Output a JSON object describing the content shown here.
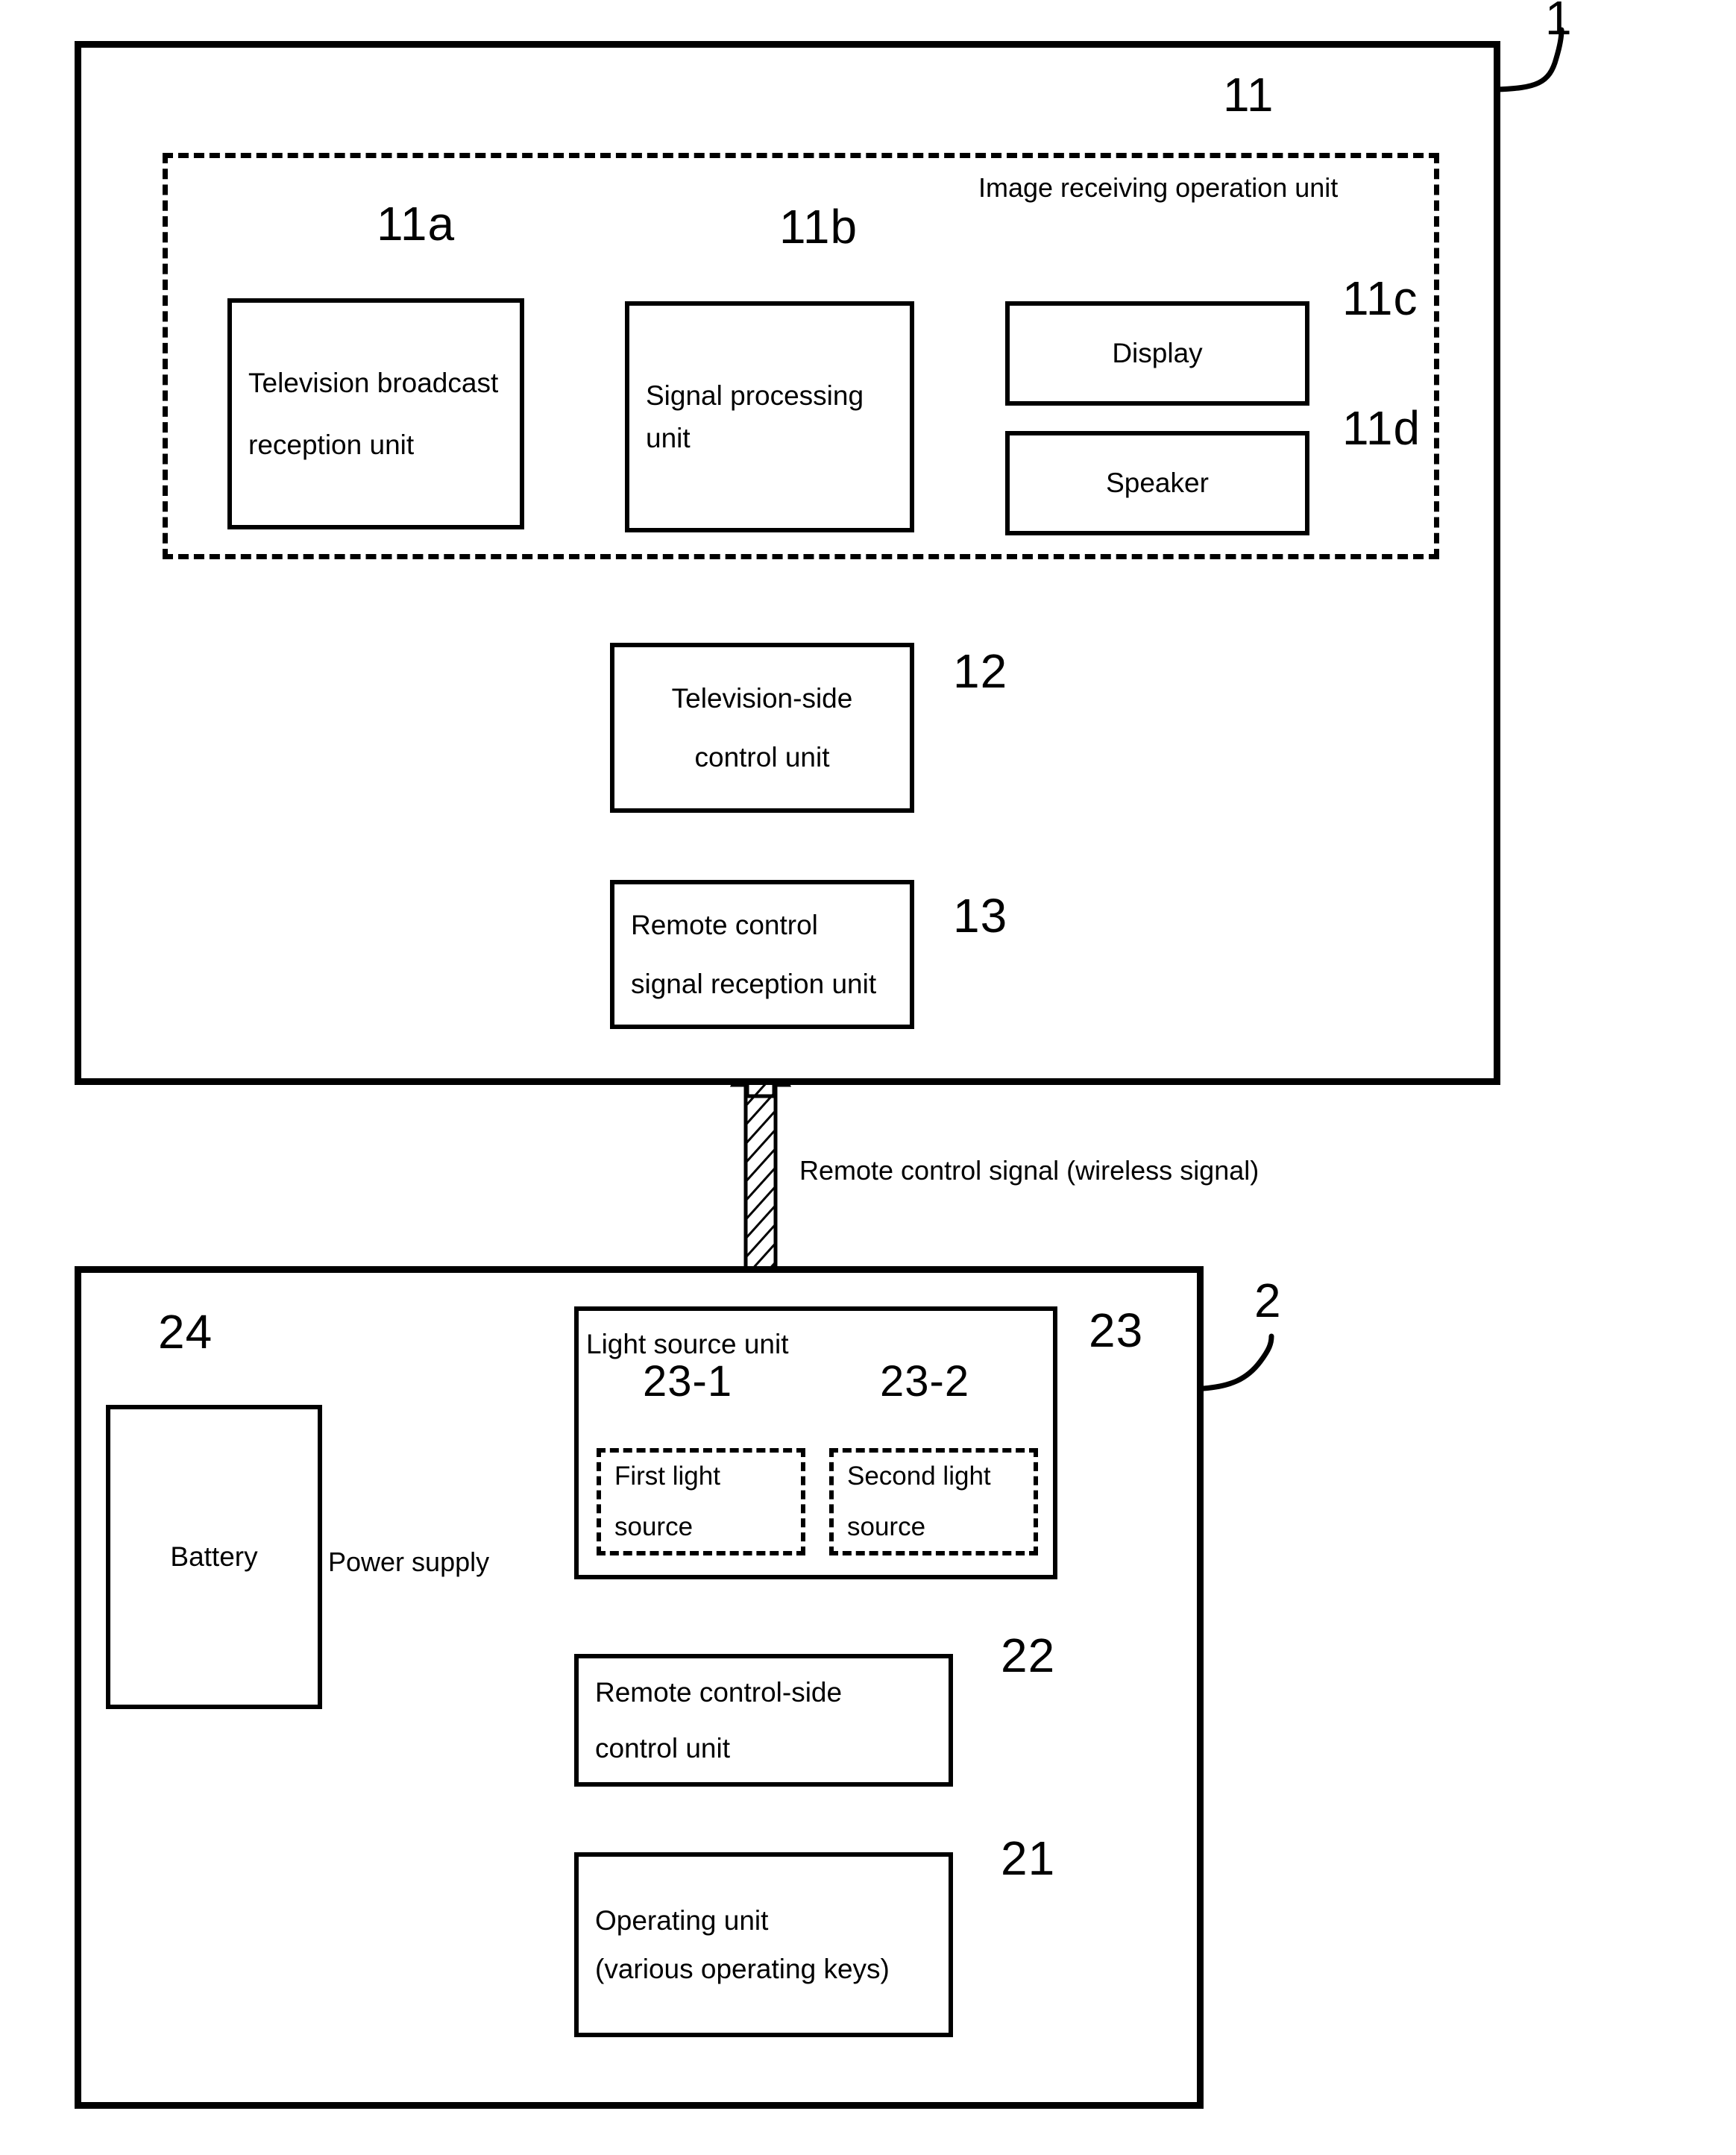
{
  "figure": {
    "type": "patent-block-diagram",
    "background": "#ffffff",
    "ink": "#000000"
  },
  "television": {
    "ref": "1",
    "image_receiving_unit": {
      "ref": "11",
      "label": "Image receiving operation unit",
      "blocks": [
        {
          "ref": "11a",
          "label": "Television broadcast\nreception unit",
          "line1": "Television broadcast",
          "line2": "reception unit"
        },
        {
          "ref": "11b",
          "label": "Signal processing unit",
          "line1": "Signal processing unit",
          "line2": ""
        },
        {
          "ref": "11c",
          "label": "Display",
          "line1": "Display",
          "line2": ""
        },
        {
          "ref": "11d",
          "label": "Speaker",
          "line1": "Speaker",
          "line2": ""
        }
      ]
    },
    "control_unit": {
      "ref": "12",
      "line1": "Television-side",
      "line2": "control unit"
    },
    "reception_unit": {
      "ref": "13",
      "line1": "Remote control",
      "line2": "signal reception unit"
    }
  },
  "link": {
    "label": "Remote control signal (wireless signal)"
  },
  "remote": {
    "ref": "2",
    "light_source_unit": {
      "ref": "23",
      "title": "Light source unit",
      "sources": [
        {
          "ref": "23-1",
          "line1": "First light",
          "line2": "source"
        },
        {
          "ref": "23-2",
          "line1": "Second light",
          "line2": "source"
        }
      ]
    },
    "control_unit": {
      "ref": "22",
      "line1": "Remote control-side",
      "line2": "control unit"
    },
    "operating_unit": {
      "ref": "21",
      "line1": "Operating unit",
      "line2": "(various operating keys)"
    },
    "battery": {
      "ref": "24",
      "label": "Battery"
    },
    "power_supply_label": "Power supply"
  }
}
